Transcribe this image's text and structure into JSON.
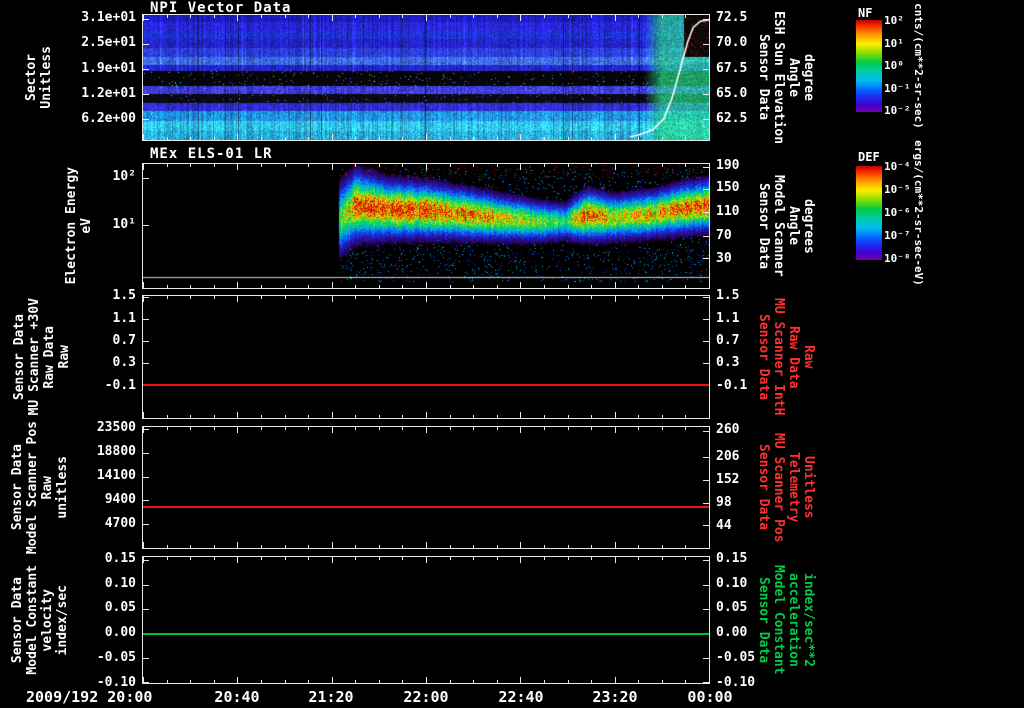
{
  "meta": {
    "background": "#000000",
    "foreground": "#ffffff",
    "red_accent": "#ff2a2a",
    "green_accent": "#00cc44"
  },
  "x_axis": {
    "start_label": "2009/192 20:00",
    "tick_labels": [
      "20:40",
      "21:20",
      "22:00",
      "22:40",
      "23:20",
      "00:00"
    ]
  },
  "panels": [
    {
      "title": "NPI Vector Data",
      "left_label_lines": [
        "Sector",
        "Unitless"
      ],
      "left_ticks": [
        {
          "t": "3.1e+01",
          "f": 0.03
        },
        {
          "t": "2.5e+01",
          "f": 0.23
        },
        {
          "t": "1.9e+01",
          "f": 0.43
        },
        {
          "t": "1.2e+01",
          "f": 0.63
        },
        {
          "t": "6.2e+00",
          "f": 0.83
        }
      ],
      "right_ticks": [
        {
          "t": "72.5",
          "f": 0.03
        },
        {
          "t": "70.0",
          "f": 0.23
        },
        {
          "t": "67.5",
          "f": 0.43
        },
        {
          "t": "65.0",
          "f": 0.63
        },
        {
          "t": "62.5",
          "f": 0.83
        }
      ],
      "right_label_lines": [
        "Sensor Data",
        "ESH Sun Elevation",
        "Angle",
        "degree"
      ],
      "right_label_color": "#ffffff"
    },
    {
      "title": "MEx ELS-01 LR",
      "left_label_lines": [
        "Electron Energy",
        "eV"
      ],
      "left_ticks": [
        {
          "t": "10²",
          "f": 0.11
        },
        {
          "t": "10¹",
          "f": 0.49
        }
      ],
      "right_ticks": [
        {
          "t": "190",
          "f": 0.02
        },
        {
          "t": "150",
          "f": 0.2
        },
        {
          "t": "110",
          "f": 0.39
        },
        {
          "t": "70",
          "f": 0.58
        },
        {
          "t": "30",
          "f": 0.76
        }
      ],
      "right_label_lines": [
        "Sensor Data",
        "Model Scanner",
        "Angle",
        "degrees"
      ],
      "right_label_color": "#ffffff"
    },
    {
      "title": "",
      "left_label_lines": [
        "Sensor Data",
        "MU Scanner +30V",
        "Raw Data",
        "Raw"
      ],
      "left_ticks": [
        {
          "t": "1.5",
          "f": 0.01
        },
        {
          "t": "1.1",
          "f": 0.19
        },
        {
          "t": "0.7",
          "f": 0.37
        },
        {
          "t": "0.3",
          "f": 0.55
        },
        {
          "t": "-0.1",
          "f": 0.73
        }
      ],
      "right_ticks": [
        {
          "t": "1.5",
          "f": 0.01
        },
        {
          "t": "1.1",
          "f": 0.19
        },
        {
          "t": "0.7",
          "f": 0.37
        },
        {
          "t": "0.3",
          "f": 0.55
        },
        {
          "t": "-0.1",
          "f": 0.73
        }
      ],
      "right_label_lines": [
        "Sensor Data",
        "MU Scanner IntH",
        "Raw Data",
        "Raw"
      ],
      "right_label_color": "#ff3030",
      "line": {
        "color": "#ee1111",
        "frac": 0.72
      }
    },
    {
      "title": "",
      "left_label_lines": [
        "Sensor Data",
        "Model Scanner Pos",
        "Raw",
        "unitless"
      ],
      "left_ticks": [
        {
          "t": "23500",
          "f": 0.02
        },
        {
          "t": "18800",
          "f": 0.215
        },
        {
          "t": "14100",
          "f": 0.41
        },
        {
          "t": "9400",
          "f": 0.605
        },
        {
          "t": "4700",
          "f": 0.8
        }
      ],
      "right_ticks": [
        {
          "t": "260",
          "f": 0.03
        },
        {
          "t": "206",
          "f": 0.25
        },
        {
          "t": "152",
          "f": 0.44
        },
        {
          "t": "98",
          "f": 0.63
        },
        {
          "t": "44",
          "f": 0.81
        }
      ],
      "right_label_lines": [
        "Sensor Data",
        "MU Scanner Pos",
        "Telemetry",
        "Unitless"
      ],
      "right_label_color": "#ff3030",
      "line": {
        "color": "#ee1111",
        "frac": 0.655
      }
    },
    {
      "title": "",
      "left_label_lines": [
        "Sensor Data",
        "Model Constant",
        "velocity",
        "index/sec"
      ],
      "left_ticks": [
        {
          "t": "0.15",
          "f": 0.02
        },
        {
          "t": "0.10",
          "f": 0.22
        },
        {
          "t": "0.05",
          "f": 0.41
        },
        {
          "t": "0.00",
          "f": 0.6
        },
        {
          "t": "-0.05",
          "f": 0.8
        },
        {
          "t": "-0.10",
          "f": 0.99
        }
      ],
      "right_ticks": [
        {
          "t": "0.15",
          "f": 0.02
        },
        {
          "t": "0.10",
          "f": 0.22
        },
        {
          "t": "0.05",
          "f": 0.41
        },
        {
          "t": "0.00",
          "f": 0.6
        },
        {
          "t": "-0.05",
          "f": 0.8
        },
        {
          "t": "-0.10",
          "f": 0.99
        }
      ],
      "right_label_lines": [
        "Sensor Data",
        "Model Constant",
        "acceleration",
        "index/sec**2"
      ],
      "right_label_color": "#00cc44",
      "line": {
        "color": "#00bb44",
        "frac": 0.6
      }
    }
  ],
  "colorbars": [
    {
      "name": "NF",
      "unit": "cnts/(cm**2-sr-sec)",
      "ticks": [
        "10²",
        "10¹",
        "10⁰",
        "10⁻¹",
        "10⁻²"
      ]
    },
    {
      "name": "DEF",
      "unit": "ergs/(cm**2-sr-sec-eV)",
      "ticks": [
        "10⁻⁴",
        "10⁻⁵",
        "10⁻⁶",
        "10⁻⁷",
        "10⁻⁸"
      ]
    }
  ],
  "chart_data": [
    {
      "type": "heatmap",
      "title": "NPI Vector Data",
      "ylabel": "Sector Unitless",
      "ytick_values": [
        31,
        25,
        19,
        12,
        6.2
      ],
      "right_axis": {
        "label": "Sensor Data ESH Sun Elevation Angle degree",
        "ticks": [
          72.5,
          70.0,
          67.5,
          65.0,
          62.5
        ]
      },
      "x_range": [
        "2009/192 20:00",
        "2009/193 00:00"
      ],
      "colorbar": {
        "name": "NF",
        "unit": "cnts/(cm**2-sr-sec)"
      },
      "bands": [
        {
          "y0": 0.0,
          "y1": 0.055,
          "color": "#1b1bb8",
          "noise": 0.25
        },
        {
          "y0": 0.055,
          "y1": 0.125,
          "color": "#2525d8",
          "noise": 0.3
        },
        {
          "y0": 0.125,
          "y1": 0.19,
          "color": "#1d2fd0",
          "noise": 0.3
        },
        {
          "y0": 0.19,
          "y1": 0.26,
          "color": "#2222c4",
          "noise": 0.3
        },
        {
          "y0": 0.26,
          "y1": 0.33,
          "color": "#2a3cdd",
          "noise": 0.3
        },
        {
          "y0": 0.33,
          "y1": 0.4,
          "color": "#3a66e8",
          "noise": 0.35
        },
        {
          "y0": 0.4,
          "y1": 0.445,
          "color": "#2424c8",
          "noise": 0.3
        },
        {
          "y0": 0.445,
          "y1": 0.565,
          "color": "#060608",
          "noise": 0.1,
          "speckle": 0.025
        },
        {
          "y0": 0.565,
          "y1": 0.625,
          "color": "#3c3ce0",
          "noise": 0.4
        },
        {
          "y0": 0.625,
          "y1": 0.7,
          "color": "#0a0a14",
          "noise": 0.15,
          "speckle": 0.02
        },
        {
          "y0": 0.7,
          "y1": 0.765,
          "color": "#2d2dd0",
          "noise": 0.3
        },
        {
          "y0": 0.765,
          "y1": 0.845,
          "color": "#2090e8",
          "noise": 0.3
        },
        {
          "y0": 0.845,
          "y1": 0.925,
          "color": "#30c0ee",
          "noise": 0.25
        },
        {
          "y0": 0.925,
          "y1": 1.0,
          "color": "#28a8dc",
          "noise": 0.3
        }
      ],
      "green_zone_start": 0.885,
      "dark_corner": {
        "x0": 0.955,
        "y0": 0.0,
        "y1": 0.33
      },
      "overlay_line": {
        "name": "sun-elevation-trace",
        "color": "#ffffff",
        "points": [
          [
            0.86,
            0.975
          ],
          [
            0.875,
            0.96
          ],
          [
            0.9,
            0.92
          ],
          [
            0.92,
            0.83
          ],
          [
            0.935,
            0.66
          ],
          [
            0.95,
            0.42
          ],
          [
            0.962,
            0.22
          ],
          [
            0.972,
            0.1
          ],
          [
            0.985,
            0.05
          ],
          [
            1.0,
            0.04
          ]
        ]
      }
    },
    {
      "type": "heatmap",
      "title": "MEx ELS-01 LR",
      "ylabel": "Electron Energy eV",
      "yscale": "log",
      "ytick_values": [
        100,
        10
      ],
      "right_axis": {
        "label": "Sensor Data Model Scanner Angle degrees",
        "ticks": [
          190,
          150,
          110,
          70,
          30
        ]
      },
      "colorbar": {
        "name": "DEF",
        "unit": "ergs/(cm**2-sr-sec-eV)"
      },
      "data_start_frac": 0.345,
      "white_line_frac": 0.91,
      "profile": [
        {
          "x": 0.345,
          "c": 0.45,
          "w": 0.2,
          "i": 0.55
        },
        {
          "x": 0.375,
          "c": 0.33,
          "w": 0.18,
          "i": 0.95
        },
        {
          "x": 0.43,
          "c": 0.36,
          "w": 0.15,
          "i": 1.0
        },
        {
          "x": 0.5,
          "c": 0.37,
          "w": 0.14,
          "i": 0.98
        },
        {
          "x": 0.57,
          "c": 0.4,
          "w": 0.13,
          "i": 0.88
        },
        {
          "x": 0.63,
          "c": 0.43,
          "w": 0.12,
          "i": 0.78
        },
        {
          "x": 0.7,
          "c": 0.46,
          "w": 0.11,
          "i": 0.62
        },
        {
          "x": 0.745,
          "c": 0.46,
          "w": 0.1,
          "i": 0.5
        },
        {
          "x": 0.785,
          "c": 0.41,
          "w": 0.13,
          "i": 1.0
        },
        {
          "x": 0.83,
          "c": 0.43,
          "w": 0.12,
          "i": 0.7
        },
        {
          "x": 0.9,
          "c": 0.4,
          "w": 0.12,
          "i": 0.8
        },
        {
          "x": 0.96,
          "c": 0.35,
          "w": 0.13,
          "i": 0.95
        },
        {
          "x": 1.0,
          "c": 0.33,
          "w": 0.13,
          "i": 0.98
        }
      ]
    },
    {
      "type": "line",
      "ylabel": "Sensor Data MU Scanner +30V Raw Data Raw",
      "right_label": "Sensor Data MU Scanner IntH Raw Data Raw",
      "ytick_values": [
        1.5,
        1.1,
        0.7,
        0.3,
        -0.1
      ],
      "right_tick_values": [
        1.5,
        1.1,
        0.7,
        0.3,
        -0.1
      ],
      "series": [
        {
          "name": "MU Scanner +30V Raw",
          "color": "#ee1111",
          "constant_value": 0.0
        }
      ]
    },
    {
      "type": "line",
      "ylabel": "Sensor Data Model Scanner Pos Raw unitless",
      "right_label": "Sensor Data MU Scanner Pos Telemetry Unitless",
      "ytick_values": [
        23500,
        18800,
        14100,
        9400,
        4700
      ],
      "right_tick_values": [
        260,
        206,
        152,
        98,
        44
      ],
      "series": [
        {
          "name": "Model Scanner Pos Raw",
          "color": "#ee1111",
          "constant_value": 8192
        }
      ]
    },
    {
      "type": "line",
      "ylabel": "Sensor Data Model Constant velocity index/sec",
      "right_label": "Sensor Data Model Constant acceleration index/sec**2",
      "ytick_values": [
        0.15,
        0.1,
        0.05,
        0.0,
        -0.05,
        -0.1
      ],
      "right_tick_values": [
        0.15,
        0.1,
        0.05,
        0.0,
        -0.05,
        -0.1
      ],
      "series": [
        {
          "name": "Model Constant velocity",
          "color": "#00bb44",
          "constant_value": 0.0
        }
      ]
    }
  ]
}
